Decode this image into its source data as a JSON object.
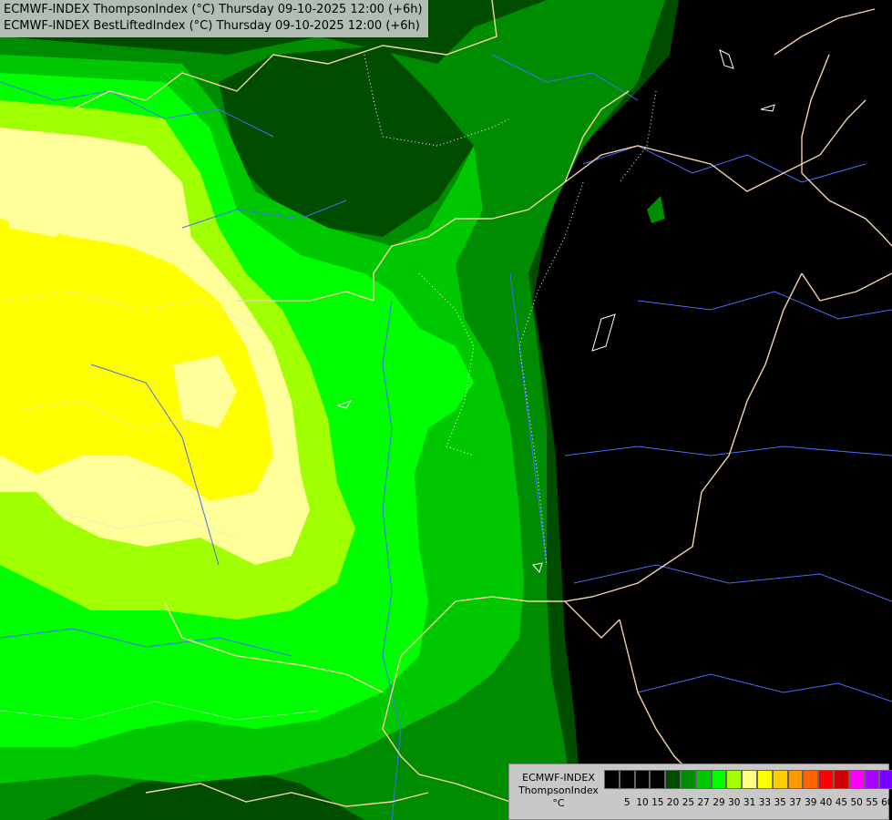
{
  "header": {
    "line1": "ECMWF-INDEX ThompsonIndex (°C) Thursday 09-10-2025 12:00 (+6h)",
    "line2": "ECMWF-INDEX BestLiftedIndex (°C) Thursday 09-10-2025 12:00 (+6h)"
  },
  "legend": {
    "name1": "ECMWF-INDEX",
    "name2": "ThompsonIndex",
    "unit": "°C",
    "ticks": [
      "5",
      "10",
      "15",
      "20",
      "25",
      "27",
      "29",
      "30",
      "31",
      "33",
      "35",
      "37",
      "39",
      "40",
      "45",
      "50",
      "55",
      "60"
    ],
    "colors": [
      "#000000",
      "#000000",
      "#000000",
      "#000000",
      "#004d00",
      "#008c00",
      "#00c800",
      "#00ff00",
      "#a0ff00",
      "#ffff80",
      "#ffff00",
      "#ffcc00",
      "#ff9900",
      "#ff6600",
      "#ff0000",
      "#cc0000",
      "#ff00ff",
      "#aa00ff",
      "#7700ff",
      "#4400ff",
      "#0000ff"
    ]
  },
  "map": {
    "fill_colors": {
      "background": "#000000",
      "dark_green": "#004d00",
      "mid_green": "#008c00",
      "green": "#00c800",
      "bright_green": "#00ff00",
      "lime": "#a0ff00",
      "pale_yellow": "#ffff99",
      "yellow": "#ffff00"
    },
    "border_color": "#f5d3a8",
    "river_color": "#4a6bff"
  }
}
